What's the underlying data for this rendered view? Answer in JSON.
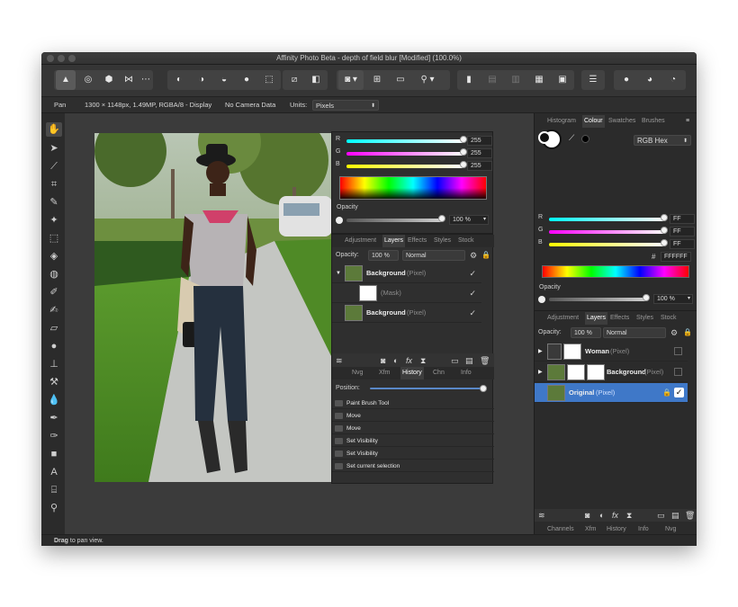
{
  "window": {
    "title": "Affinity Photo Beta - depth of field blur [Modified] (100.0%)"
  },
  "toolbar": {
    "groups": [
      {
        "name": "persona-photo",
        "glyph": "▲"
      },
      {
        "name": "persona-liquify",
        "glyph": "◎"
      },
      {
        "name": "persona-develop",
        "glyph": "⬢"
      },
      {
        "name": "persona-tonemap",
        "glyph": "⋈"
      },
      {
        "name": "persona-export",
        "glyph": "⋯"
      }
    ]
  },
  "context": {
    "tool_name": "Pan",
    "doc_info": "1300 × 1148px, 1.49MP, RGBA/8 - Display",
    "camera": "No Camera Data",
    "units_label": "Units:",
    "units_value": "Pixels"
  },
  "colour_float": {
    "r_label": "R",
    "r_value": "255",
    "g_label": "G",
    "g_value": "255",
    "b_label": "B",
    "b_value": "255",
    "opacity_label": "Opacity",
    "opacity_value": "100 %"
  },
  "layers_float": {
    "tabs": [
      "Adjustment",
      "Layers",
      "Effects",
      "Styles",
      "Stock"
    ],
    "active_tab": "Layers",
    "opacity_label": "Opacity:",
    "opacity_value": "100 %",
    "blend": "Normal",
    "rows": [
      {
        "name": "Background",
        "type": "(Pixel)"
      },
      {
        "name": "(Mask)",
        "type": ""
      },
      {
        "name": "Background",
        "type": "(Pixel)"
      }
    ]
  },
  "history_float": {
    "tabs": [
      "Nvg",
      "Xfm",
      "History",
      "Chn",
      "Info"
    ],
    "active_tab": "History",
    "position_label": "Position:",
    "items": [
      "Paint Brush Tool",
      "Move",
      "Move",
      "Set Visibility",
      "Set Visibility",
      "Set current selection"
    ]
  },
  "right_colour": {
    "tabs": [
      "Histogram",
      "Colour",
      "Swatches",
      "Brushes"
    ],
    "active_tab": "Colour",
    "model": "RGB Hex",
    "r_label": "R",
    "r_value": "FF",
    "g_label": "G",
    "g_value": "FF",
    "b_label": "B",
    "b_value": "FF",
    "hex_value": "FFFFFF",
    "opacity_label": "Opacity",
    "opacity_value": "100 %"
  },
  "right_layers": {
    "tabs": [
      "Adjustment",
      "Layers",
      "Effects",
      "Styles",
      "Stock"
    ],
    "active_tab": "Layers",
    "opacity_label": "Opacity:",
    "opacity_value": "100 %",
    "blend": "Normal",
    "rows": [
      {
        "name": "Woman",
        "type": "(Pixel)",
        "selected": false
      },
      {
        "name": "Background",
        "type": "(Pixel)",
        "selected": false
      },
      {
        "name": "Original",
        "type": "(Pixel)",
        "selected": true
      }
    ],
    "bottom_tabs": [
      "Channels",
      "Xfm",
      "History",
      "Info",
      "Nvg"
    ]
  },
  "status": {
    "strong": "Drag",
    "rest": " to pan view."
  },
  "colors": {
    "accent": "#3f78c8",
    "panel": "#2f2f2f"
  }
}
